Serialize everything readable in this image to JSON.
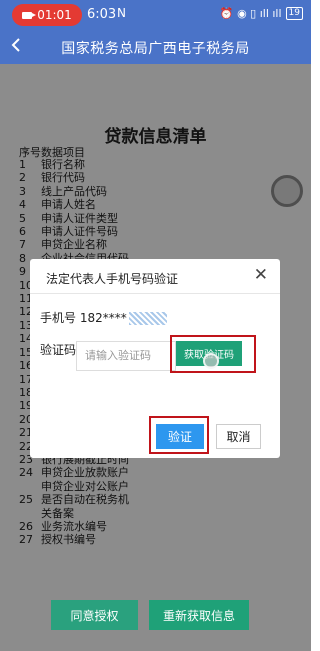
{
  "status_bar": {
    "recording_time": "01:01",
    "time": "6:03",
    "nfc": "N",
    "right_icons": "⏰ ◉ ▯ ıll ıll",
    "battery": "19"
  },
  "nav": {
    "back_icon": "chevron-left-icon",
    "title": "国家税务总局广西电子税务局"
  },
  "document": {
    "title": "贷款信息清单",
    "list_header": "序号数据项目",
    "items": [
      {
        "num": "1",
        "label": "银行名称"
      },
      {
        "num": "2",
        "label": "银行代码"
      },
      {
        "num": "3",
        "label": "线上产品代码"
      },
      {
        "num": "4",
        "label": "申请人姓名"
      },
      {
        "num": "5",
        "label": "申请人证件类型"
      },
      {
        "num": "6",
        "label": "申请人证件号码"
      },
      {
        "num": "7",
        "label": "申贷企业名称"
      },
      {
        "num": "8",
        "label": "企业社会信用代码"
      },
      {
        "num": "9",
        "label": ""
      },
      {
        "num": "10",
        "label": ""
      },
      {
        "num": "11",
        "label": ""
      },
      {
        "num": "12",
        "label": ""
      },
      {
        "num": "13",
        "label": ""
      },
      {
        "num": "14",
        "label": ""
      },
      {
        "num": "15",
        "label": ""
      },
      {
        "num": "16",
        "label": ""
      },
      {
        "num": "17",
        "label": ""
      },
      {
        "num": "18",
        "label": ""
      },
      {
        "num": "19",
        "label": ""
      },
      {
        "num": "20",
        "label": ""
      },
      {
        "num": "",
        "label": ""
      },
      {
        "num": "21",
        "label": ""
      },
      {
        "num": "",
        "label": ""
      },
      {
        "num": "22",
        "label": "银行是否同意展期"
      },
      {
        "num": "23",
        "label": "银行展期截止时间"
      },
      {
        "num": "24",
        "label": "申贷企业放款账户"
      },
      {
        "num": "",
        "label": "申贷企业对公账户"
      },
      {
        "num": "25",
        "label": "是否自动在税务机"
      },
      {
        "num": "",
        "label": "关备案"
      },
      {
        "num": "26",
        "label": "业务流水编号"
      },
      {
        "num": "27",
        "label": "授权书编号"
      }
    ],
    "agree_button": "同意授权",
    "reget_button": "重新获取信息"
  },
  "dialog": {
    "title": "法定代表人手机号码验证",
    "close_icon": "close-icon",
    "phone_label": "手机号",
    "phone_value": "182****",
    "code_label": "验证码",
    "code_placeholder": "请输入验证码",
    "get_code_button": "获取验证码",
    "verify_button": "验证",
    "cancel_button": "取消"
  }
}
